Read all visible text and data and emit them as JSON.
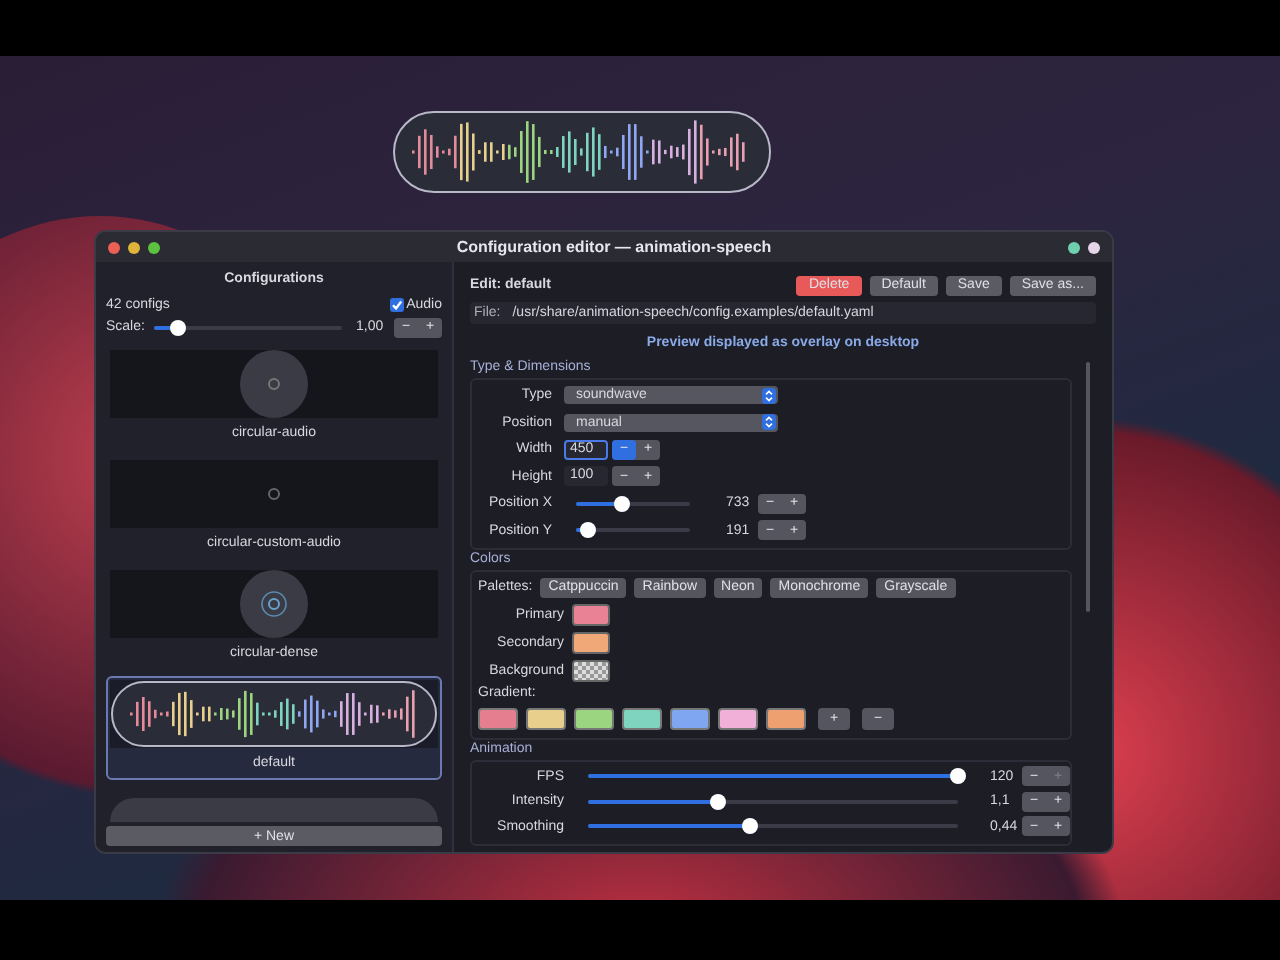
{
  "desktop": {
    "overlay": {
      "kind": "wave"
    }
  },
  "window": {
    "title": "Configuration editor — animation-speech"
  },
  "sidebar": {
    "title": "Configurations",
    "count": "42 configs",
    "audio": {
      "label": "Audio",
      "checked": true
    },
    "scale": {
      "label": "Scale:",
      "level": 0.12,
      "value": "1,00",
      "minus": "−",
      "plus": "+"
    },
    "items": [
      {
        "kind": "circle",
        "label": "circular-audio",
        "selected": false
      },
      {
        "kind": "dot",
        "label": "circular-custom-audio",
        "selected": false
      },
      {
        "kind": "rings",
        "label": "circular-dense",
        "selected": false
      },
      {
        "kind": "wave",
        "label": "default",
        "selected": true
      },
      {
        "kind": "pill",
        "selected": false
      }
    ],
    "new_button": "+ New"
  },
  "editor": {
    "heading": "Edit: default",
    "buttons": [
      {
        "label": "Delete",
        "kind": "danger"
      },
      {
        "label": "Default",
        "kind": "normal"
      },
      {
        "label": "Save",
        "kind": "normal"
      },
      {
        "label": "Save as...",
        "kind": "normal"
      }
    ],
    "file": {
      "label": "File:",
      "value": "/usr/share/animation-speech/config.examples/default.yaml"
    },
    "notice": "Preview displayed as overlay on desktop",
    "sections": [
      {
        "kind": "rows",
        "title": "Type & Dimensions",
        "rows": [
          {
            "kind": "select",
            "label": "Type",
            "value": "soundwave"
          },
          {
            "kind": "select",
            "label": "Position",
            "value": "manual"
          },
          {
            "kind": "spin",
            "label": "Width",
            "value": "450",
            "focused": true,
            "minus": "−",
            "plus": "+",
            "minus_pressed": true
          },
          {
            "kind": "spin",
            "label": "Height",
            "value": "100",
            "focused": false,
            "minus": "−",
            "plus": "+",
            "minus_pressed": false
          },
          {
            "kind": "slider",
            "label": "Position X",
            "level": 0.4,
            "value": "733",
            "minus": "−",
            "plus": "+",
            "plus_disabled": false
          },
          {
            "kind": "slider",
            "label": "Position Y",
            "level": 0.1,
            "value": "191",
            "minus": "−",
            "plus": "+",
            "plus_disabled": false
          }
        ]
      },
      {
        "kind": "colors",
        "title": "Colors",
        "palettes_label": "Palettes:",
        "palettes": [
          "Catppuccin",
          "Rainbow",
          "Neon",
          "Monochrome",
          "Grayscale"
        ],
        "swatches": [
          {
            "kind": "color",
            "label": "Primary",
            "color": "#e98294"
          },
          {
            "kind": "color",
            "label": "Secondary",
            "color": "#f0a878"
          },
          {
            "kind": "checker",
            "label": "Background"
          }
        ],
        "gradient_label": "Gradient:",
        "gradient": [
          {
            "color": "#e57f8f"
          },
          {
            "color": "#e8cf8c"
          },
          {
            "color": "#9bd57f"
          },
          {
            "color": "#7fd4c0"
          },
          {
            "color": "#7fa6f0"
          },
          {
            "color": "#f0b0d8"
          },
          {
            "color": "#efa070"
          }
        ],
        "gradient_add": "+",
        "gradient_remove": "−"
      },
      {
        "kind": "rows",
        "title": "Animation",
        "rows": [
          {
            "kind": "wide-slider",
            "label": "FPS",
            "level": 1,
            "value": "120",
            "minus": "−",
            "plus": "+",
            "plus_disabled": true
          },
          {
            "kind": "wide-slider",
            "label": "Intensity",
            "level": 0.35,
            "value": "1,1",
            "minus": "−",
            "plus": "+",
            "plus_disabled": false
          },
          {
            "kind": "wide-slider",
            "label": "Smoothing",
            "level": 0.44,
            "value": "0,44",
            "minus": "−",
            "plus": "+",
            "plus_disabled": false
          }
        ]
      }
    ]
  }
}
